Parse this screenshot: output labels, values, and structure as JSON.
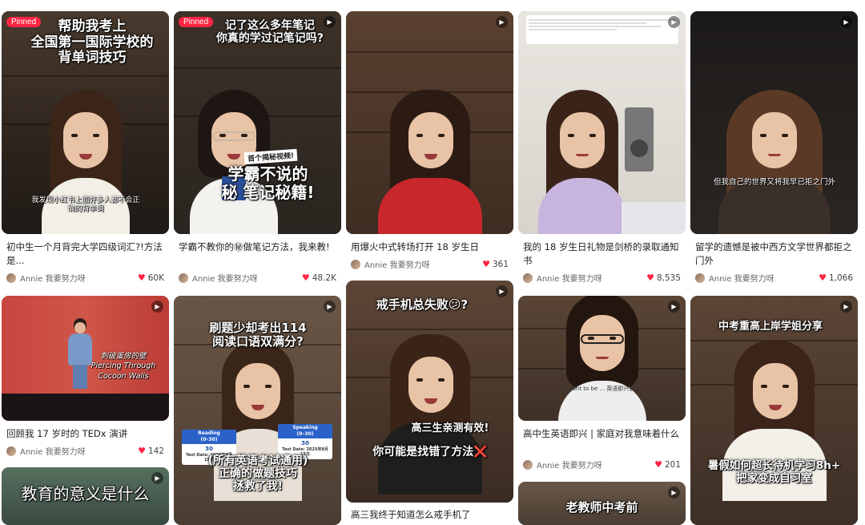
{
  "pinned_label": "Pinned",
  "play_icon": "play-icon",
  "colors": {
    "accent": "#ff2442",
    "heart": "#ff2442"
  },
  "columns": [
    {
      "cards": [
        {
          "pinned": true,
          "overlay": "帮助我考上\n全国第一国际学校的\n背单词技巧",
          "subtitle": "我发现小红书上面好多人都不会正\n确的背单词",
          "title": "初中生一个月背完大学四级词汇?!方法是...",
          "author": "Annie 我要努力呀",
          "likes": "60K"
        },
        {
          "subtitle": "刺破蛋房的壁\nPiercing Through\nCocoon Walls",
          "title": "回顾我 17 岁时的 TEDx 演讲",
          "author": "Annie 我要努力呀",
          "likes": "142"
        },
        {
          "overlay": "教育的意义是什么"
        }
      ]
    },
    {
      "cards": [
        {
          "pinned": true,
          "overlay": "记了这么多年笔记\n你真的学过记笔记吗?",
          "overlay2": "学霸不说的\n秘 笔记秘籍!",
          "tag": "首个揭秘视频!",
          "title": "学霸不教你的㊙做笔记方法，我来教!",
          "author": "Annie 我要努力呀",
          "likes": "48.2K"
        },
        {
          "overlay": "刷题少却考出114\n阅读口语双满分?",
          "overlay2": "(所有英语考试通用)\n正确的做题技巧\n拯救了我!",
          "score_left": {
            "head": "Reading\n(0–30)",
            "value": "30",
            "date": "Test Date: 2025年8月15日"
          },
          "score_right": {
            "head": "Speaking\n(0–30)",
            "value": "30",
            "date": "Test Date: 2025年8月15日"
          }
        }
      ]
    },
    {
      "cards": [
        {
          "title": "用爆火中式转场打开 18 岁生日",
          "author": "Annie 我要努力呀",
          "likes": "361"
        },
        {
          "overlay": "戒手机总失败😕?",
          "overlay2": "高三生亲测有效!",
          "overlay3": "你可能是找错了方法❌",
          "title": "高三我终于知道怎么戒手机了"
        }
      ]
    },
    {
      "cards": [
        {
          "title": "我的 18 岁生日礼物是剑桥的录取通知书",
          "author": "Annie 我要努力呀",
          "likes": "8,535"
        },
        {
          "subtitle": "I want to be ... 英语即兴表达",
          "title": "高中生英语即兴 | 家庭对我意味着什么",
          "author": "Annie 我要努力呀",
          "likes": "201"
        },
        {
          "overlay": "老教师中考前"
        }
      ]
    },
    {
      "cards": [
        {
          "subtitle": "但我自己的世界又将我早已拒之门外",
          "title": "留学的遗憾是被中西方文学世界都拒之门外",
          "author": "Annie 我要努力呀",
          "likes": "1,066"
        },
        {
          "overlay": "中考重高上岸学姐分享",
          "overlay2": "暑假如何超长待机学习8h+\n把家变成自习室"
        }
      ]
    }
  ]
}
